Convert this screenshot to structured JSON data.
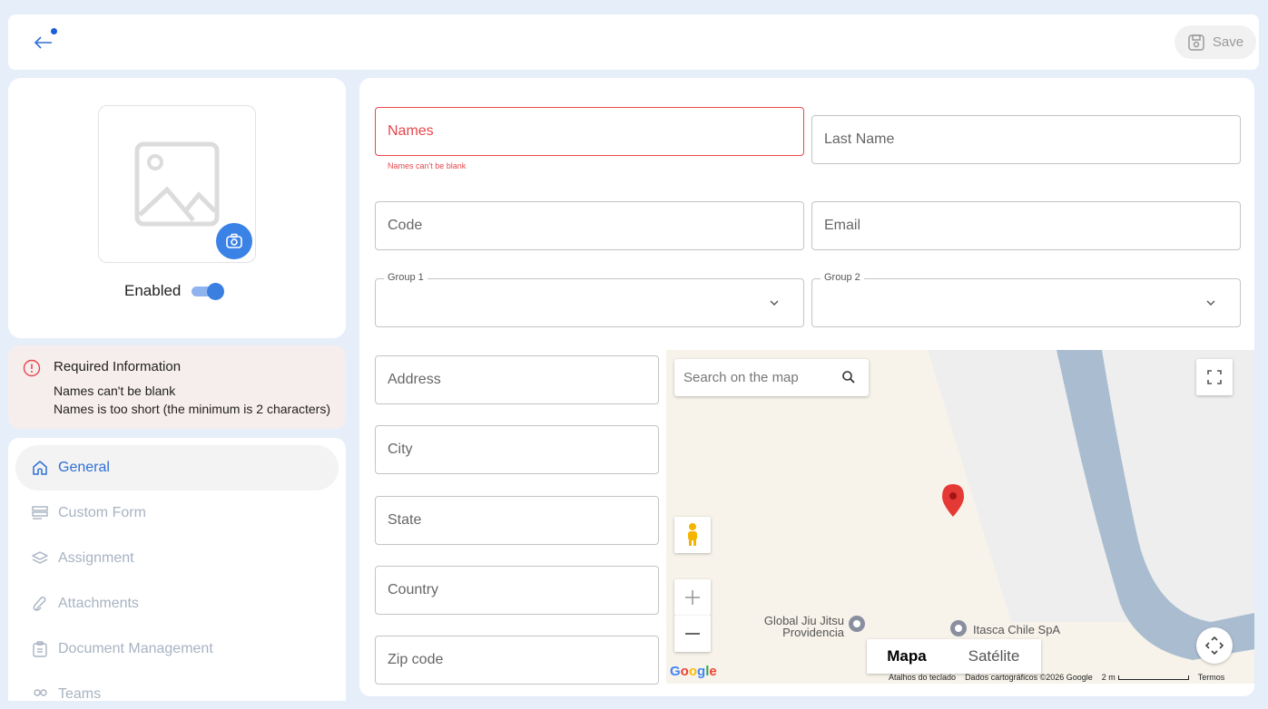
{
  "toolbar": {
    "save_label": "Save"
  },
  "profile": {
    "enabled_label": "Enabled",
    "enabled": true
  },
  "required_info": {
    "title": "Required Information",
    "messages": [
      "Names can't be blank",
      "Names is too short (the minimum is 2 characters)"
    ]
  },
  "nav": {
    "items": [
      {
        "label": "General",
        "icon": "home-icon",
        "active": true
      },
      {
        "label": "Custom Form",
        "icon": "form-icon",
        "active": false
      },
      {
        "label": "Assignment",
        "icon": "layers-icon",
        "active": false
      },
      {
        "label": "Attachments",
        "icon": "paperclip-icon",
        "active": false
      },
      {
        "label": "Document Management",
        "icon": "clipboard-icon",
        "active": false
      },
      {
        "label": "Teams",
        "icon": "team-icon",
        "active": false
      }
    ]
  },
  "form": {
    "names_label": "Names",
    "names_error": "Names can't be blank",
    "last_name_label": "Last Name",
    "code_label": "Code",
    "email_label": "Email",
    "group1_label": "Group 1",
    "group2_label": "Group 2",
    "address_label": "Address",
    "city_label": "City",
    "state_label": "State",
    "country_label": "Country",
    "zip_label": "Zip code"
  },
  "map": {
    "search_placeholder": "Search on the map",
    "poi_1": "Global Jiu Jitsu Providencia",
    "poi_1_line1": "Global Jiu Jitsu",
    "poi_1_line2": "Providencia",
    "poi_2": "Itasca Chile SpA",
    "type_map": "Mapa",
    "type_satellite": "Satélite",
    "footer_keyboard": "Atalhos do teclado",
    "footer_data": "Dados cartográficos ©2026 Google",
    "footer_scale": "2 m",
    "footer_terms": "Termos",
    "logo": "Google",
    "colors": {
      "land": "#f7f3ea",
      "area": "#eeeeee",
      "river": "#aabdd0",
      "pin": "#e53935"
    }
  }
}
